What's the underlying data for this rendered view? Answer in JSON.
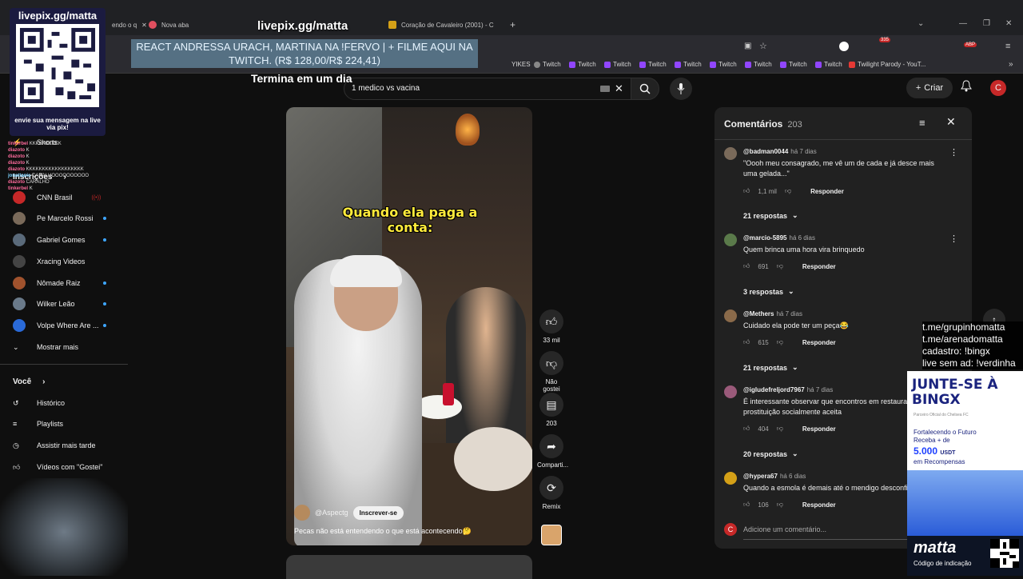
{
  "browser": {
    "tabs": [
      {
        "label": "endo o q"
      },
      {
        "label": "Nova aba"
      },
      {
        "label": "Coração de Cavaleiro (2001) - C"
      }
    ],
    "bookmarks": [
      "Twitch",
      "Twitch",
      "Twitch",
      "Twitch",
      "Twitch",
      "Twitch",
      "Twitch",
      "Twitch",
      "Twitch"
    ],
    "bookmark_other": [
      "YIKES",
      "Twilight Parody - YouT..."
    ],
    "ext_badges": [
      "335",
      "ABP"
    ]
  },
  "youtube": {
    "search_value": "1 medico vs vacina",
    "create_label": "Criar",
    "avatar_letter": "C"
  },
  "sidebar": {
    "shorts": "Shorts",
    "inscricoes": "Inscrições",
    "channels": [
      "CNN Brasil",
      "Pe Marcelo Rossi",
      "Gabriel Gomes",
      "Xracing Videos",
      "Nômade Raiz",
      "Wilker Leão",
      "Volpe Where Are ..."
    ],
    "show_more": "Mostrar mais",
    "voce": "Você",
    "voce_items": [
      "Histórico",
      "Playlists",
      "Assistir mais tarde",
      "Vídeos com \"Gostei\""
    ]
  },
  "video": {
    "overlay_caption": "Quando ela paga a conta:",
    "channel": "@Aspectg",
    "subscribe": "Inscrever-se",
    "title": "Pecas não está entendendo o que está acontecendo🤔",
    "actions": {
      "likes": "33 mil",
      "dislike": "Não gostei",
      "comments": "203",
      "share": "Comparti...",
      "remix": "Remix"
    }
  },
  "comments": {
    "title": "Comentários",
    "count": "203",
    "items": [
      {
        "user": "@badman0044",
        "when": "há 7 dias",
        "text": "\"Oooh meu consagrado, me vê um de cada e já desce mais uma gelada...\"",
        "likes": "1,1 mil",
        "replies": "21 respostas",
        "color": "#7a6a5a"
      },
      {
        "user": "@marcio-5895",
        "when": "há 6 dias",
        "text": "Quem brinca uma hora vira brinquedo",
        "likes": "691",
        "replies": "3 respostas",
        "color": "#5a7a4a"
      },
      {
        "user": "@Methers",
        "when": "há 7 dias",
        "text": "Cuidado ela pode ter um peça😂",
        "likes": "615",
        "replies": "21 respostas",
        "color": "#8a6a4a"
      },
      {
        "user": "@igludefreljord7967",
        "when": "há 7 dias",
        "text": "É interessante observar que encontros em restaurantes são a prostituição socialmente aceita",
        "likes": "404",
        "replies": "20 respostas",
        "color": "#9a5a7a"
      },
      {
        "user": "@hypera67",
        "when": "há 6 dias",
        "text": "Quando a esmola é demais até o mendigo desconfia",
        "likes": "106",
        "replies": "",
        "color": "#d4a017"
      }
    ],
    "reply_label": "Responder",
    "add_placeholder": "Adicione um comentário..."
  },
  "stream": {
    "qr_title": "livepix.gg/matta",
    "qr_foot": "envie sua mensagem na live via pix!",
    "watermark": "livepix.gg/matta",
    "banner": "REACT ANDRESSA URACH, MARTINA NA !FERVO | + FILME AQUI NA TWITCH. (R$ 128,00/R$ 224,41)",
    "termina": "Termina em um dia",
    "chat": [
      {
        "user": "tinkerbel",
        "msg": "KKKKKKKKKK"
      },
      {
        "user": "diazoto",
        "msg": "K"
      },
      {
        "user": "diazoto",
        "msg": "K"
      },
      {
        "user": "diazoto",
        "msg": "K"
      },
      {
        "user": "diazoto",
        "msg": "KKKKKKKKKKKKKKKKKK"
      },
      {
        "user": "jonattanic",
        "msg": "CARALHOOOOOOOOOO"
      },
      {
        "user": "diazoto",
        "msg": "CARALHO"
      },
      {
        "user": "tinkerbel",
        "msg": "K"
      }
    ],
    "right_info": [
      "t.me/grupinhomatta",
      "t.me/arenadomatta",
      "cadastro: !bingx",
      "live sem ad: !verdinha"
    ],
    "bingx": {
      "headline": "JUNTE-SE À BINGX",
      "partner": "Parceiro Oficial do Chelsea FC",
      "line1": "Fortalecendo o Futuro",
      "line2": "Receba + de",
      "amount": "5.000",
      "currency": "USDT",
      "line3": "em Recompensas",
      "brand": "matta",
      "code": "Código de indicação"
    }
  },
  "colors": {
    "accent_red": "#c62828",
    "yt_bg": "#0f0f0f",
    "panel_bg": "#212121",
    "link_blue": "#3ea6ff"
  }
}
